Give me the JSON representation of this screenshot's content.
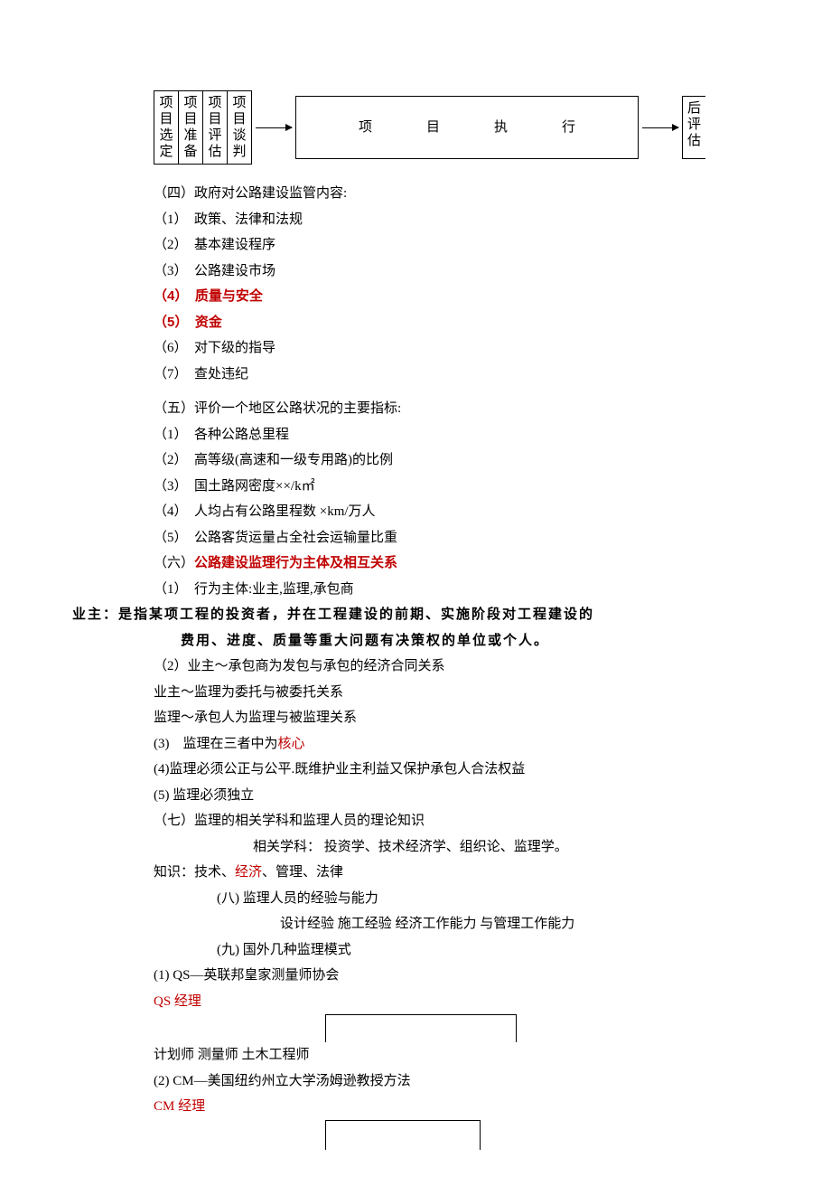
{
  "flow": {
    "cells": [
      "项目选定",
      "项目准备",
      "项目评估",
      "项目谈判"
    ],
    "mid": "项目执行",
    "end": "后评估"
  },
  "s4": {
    "title": "（四）政府对公路建设监管内容:",
    "i1": "（1）　政策、法律和法规",
    "i2": "（2）　基本建设程序",
    "i3": "（3）　公路建设市场",
    "i4": "（4）　质量与安全",
    "i5": "（5）　资金",
    "i6": "（6）　对下级的指导",
    "i7": "（7）　查处违纪"
  },
  "s5": {
    "title": "（五）评价一个地区公路状况的主要指标:",
    "i1": "（1）　各种公路总里程",
    "i2": "（2）　高等级(高速和一级专用路)的比例",
    "i3": "（3）　国土路网密度××/k㎡",
    "i4": "（4）　人均占有公路里程数  ×km/万人",
    "i5": "（5）　公路客货运量占全社会运输量比重"
  },
  "s6": {
    "title_pre": "（六）",
    "title_red": "公路建设监理行为主体及相互关系",
    "i1": "（1）　行为主体:业主,监理,承包商",
    "owner1": "业主：是指某项工程的投资者，并在工程建设的前期、实施阶段对工程建设的",
    "owner2": "费用、进度、质量等重大问题有决策权的单位或个人。",
    "i2": "（2）业主～承包商为发包与承包的经济合同关系",
    "i2b": "业主～监理为委托与被委托关系",
    "i2c": "监理～承包人为监理与被监理关系",
    "i3_pre": "(3)　监理在三者中为",
    "i3_red": "核心",
    "i4": "(4)监理必须公正与公平.既维护业主利益又保护承包人合法权益",
    "i5": "(5) 监理必须独立"
  },
  "s7": {
    "title": "（七）监理的相关学科和监理人员的理论知识",
    "line1": "相关学科：  投资学、技术经济学、组织论、监理学。",
    "k_pre": "知识：技术、",
    "k_red": "经济",
    "k_post": "、管理、法律"
  },
  "s8": {
    "title": "(八)  监理人员的经验与能力",
    "line1": "设计经验   施工经验     经济工作能力      与管理工作能力"
  },
  "s9": {
    "title": "(九)  国外几种监理模式",
    "i1": "(1)                   QS—英联邦皇家测量师协会",
    "qs": "QS 经理",
    "roles": "计划师  测量师  土木工程师",
    "i2": "(2)                   CM—美国纽约州立大学汤姆逊教授方法",
    "cm": "CM 经理"
  }
}
